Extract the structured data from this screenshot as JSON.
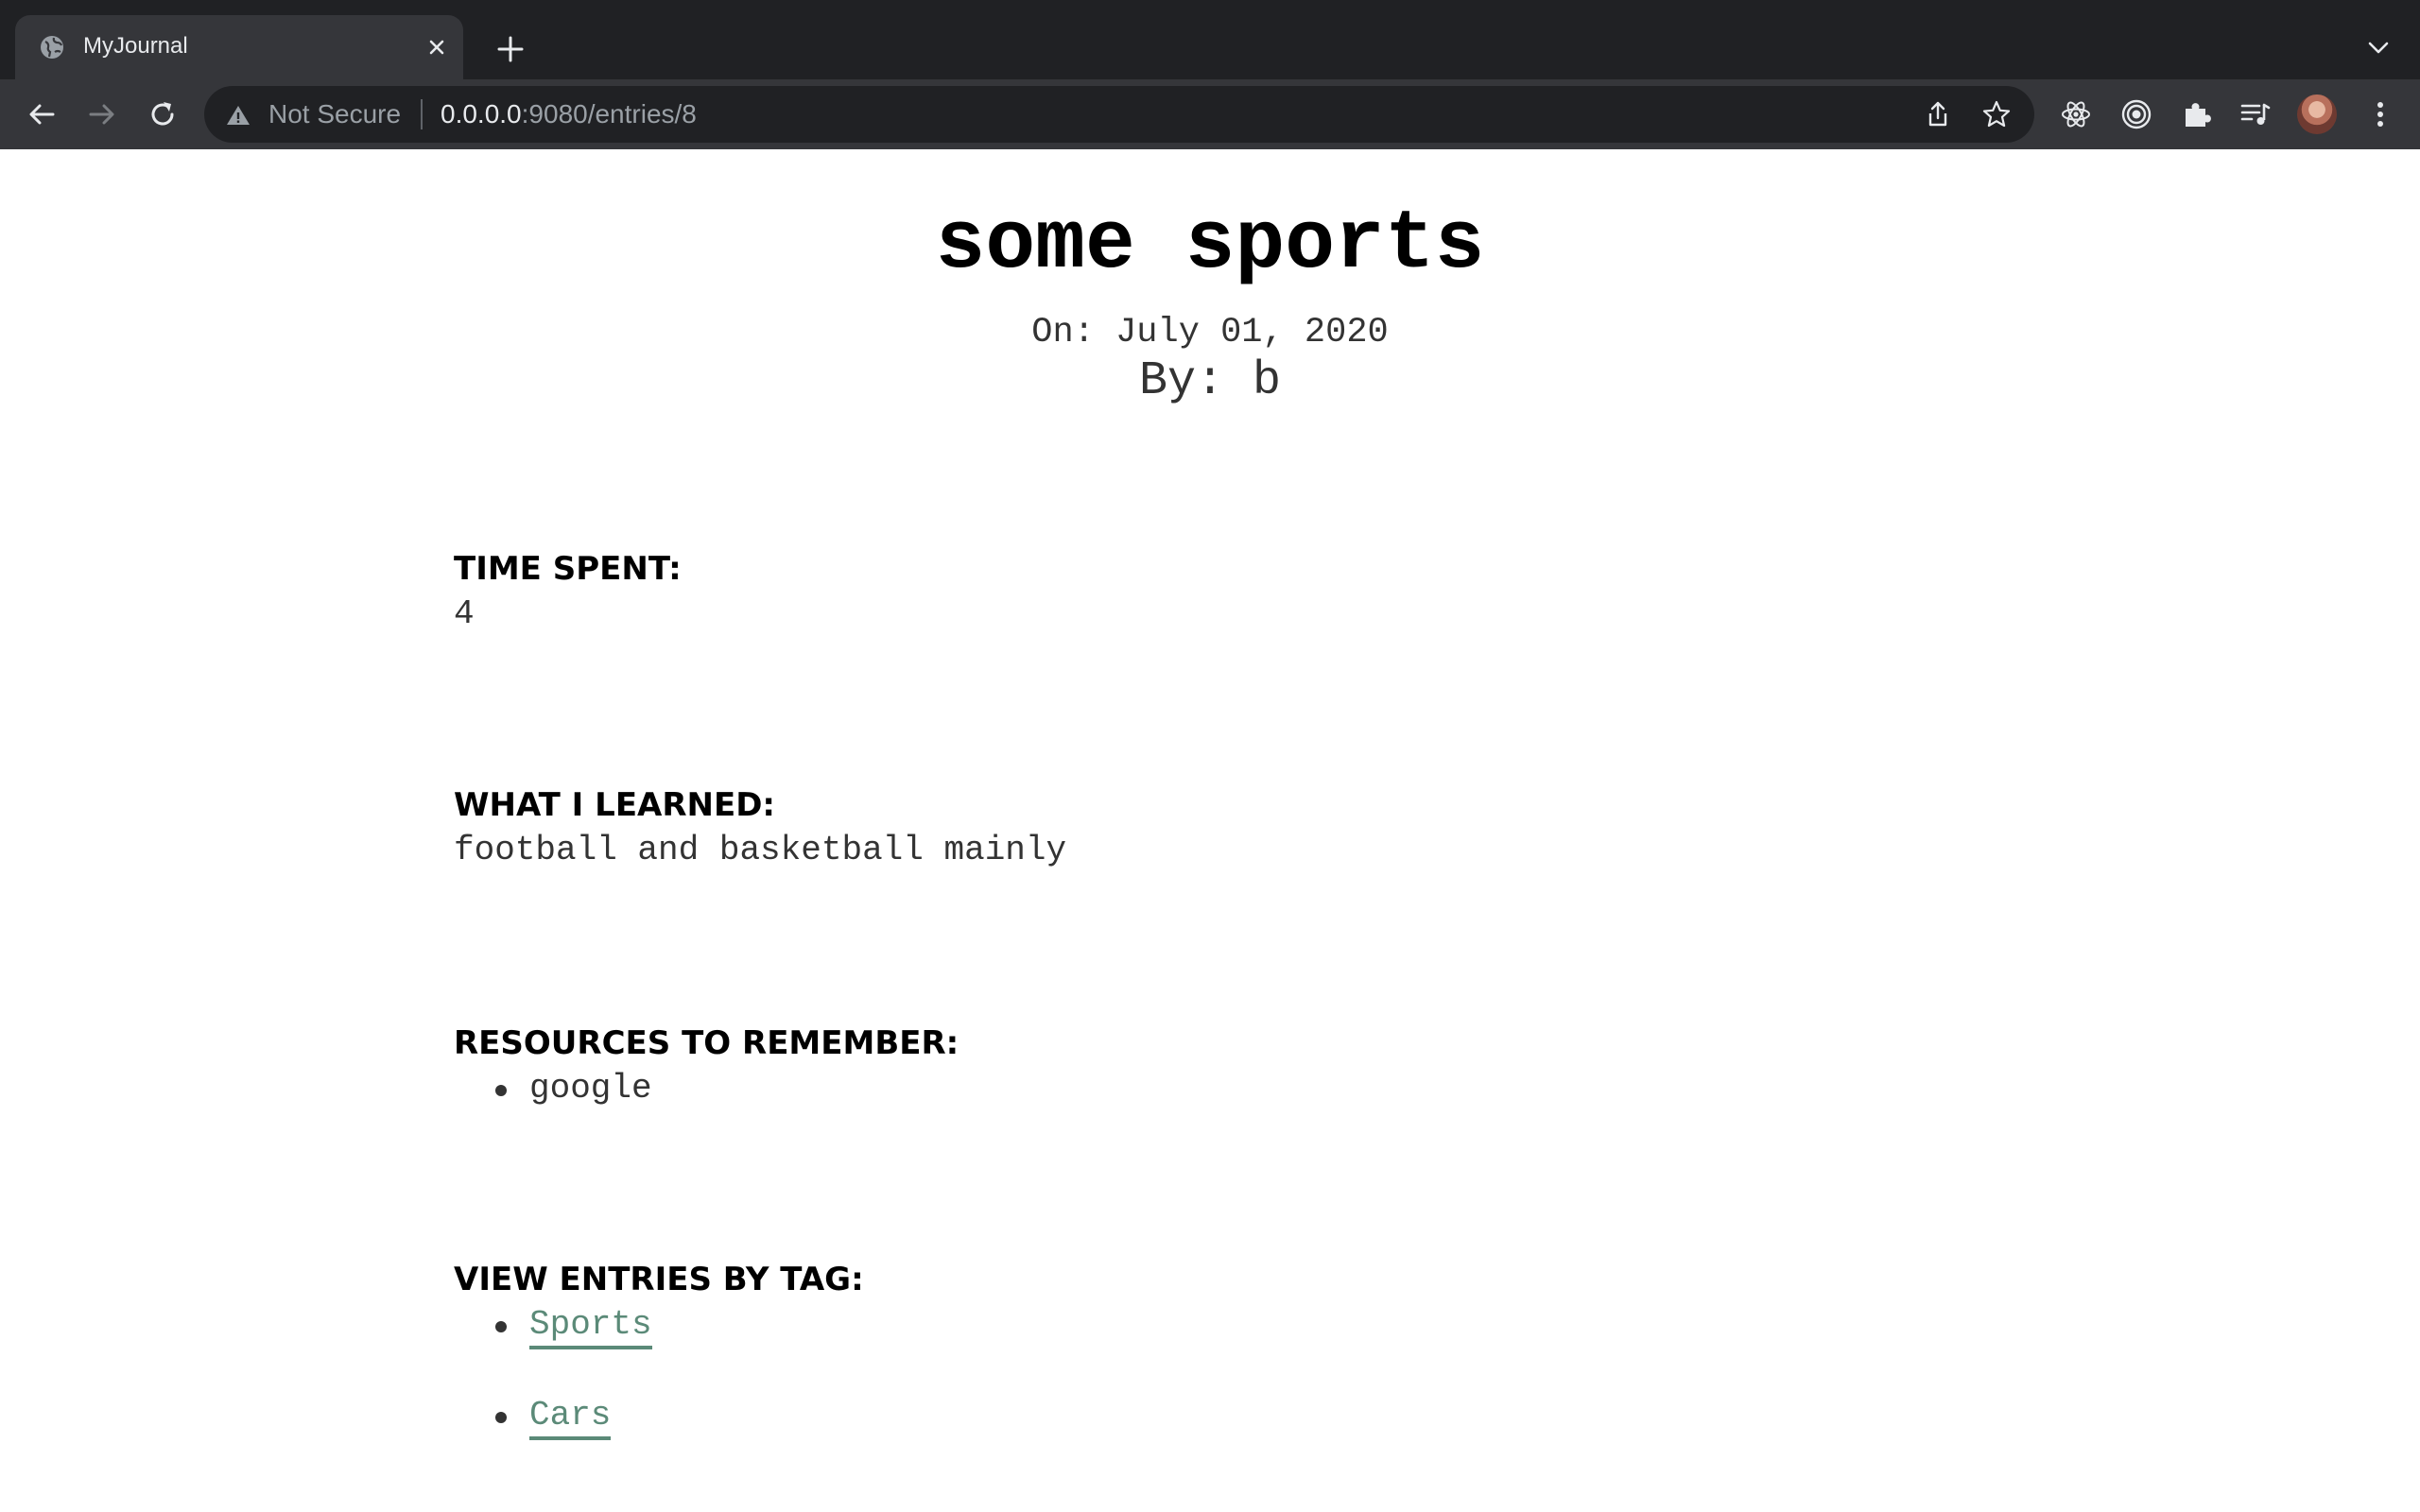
{
  "browser": {
    "tab": {
      "title": "MyJournal",
      "favicon": "globe-icon"
    },
    "address": {
      "security_label": "Not Secure",
      "url_host": "0.0.0.0",
      "url_rest": ":9080/entries/8"
    },
    "colors": {
      "tabbar": "#202124",
      "toolbar": "#35363a",
      "omnibox": "#202124"
    }
  },
  "entry": {
    "title": "some sports",
    "date": "On: July 01, 2020",
    "author": "By: b",
    "sections": {
      "time_spent": {
        "heading": "TIME SPENT:",
        "value": "4"
      },
      "learned": {
        "heading": "WHAT I LEARNED:",
        "value": "football and basketball mainly"
      },
      "resources": {
        "heading": "RESOURCES TO REMEMBER:",
        "items": [
          "google"
        ]
      },
      "tags": {
        "heading": "VIEW ENTRIES BY TAG:",
        "items": [
          "Sports",
          "Cars"
        ]
      }
    }
  },
  "colors": {
    "link": "#5b8a78",
    "text": "#333333"
  }
}
